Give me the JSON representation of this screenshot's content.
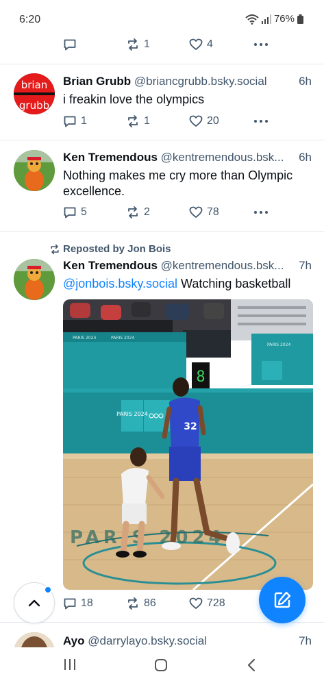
{
  "status": {
    "time": "6:20",
    "battery": "76%"
  },
  "top_actions": {
    "reposts": "1",
    "likes": "4"
  },
  "posts": [
    {
      "author": "Brian Grubb",
      "handle": "@briancgrubb.bsky.social",
      "time": "6h",
      "text": "i freakin love the olympics",
      "avatar_text": [
        "brian",
        "grubb"
      ],
      "replies": "1",
      "reposts": "1",
      "likes": "20"
    },
    {
      "author": "Ken Tremendous",
      "handle": "@kentremendous.bsk...",
      "time": "6h",
      "text": "Nothing makes me cry more than Olympic excellence.",
      "replies": "5",
      "reposts": "2",
      "likes": "78"
    },
    {
      "repost_label": "Reposted by Jon Bois",
      "author": "Ken Tremendous",
      "handle": "@kentremendous.bsk...",
      "time": "7h",
      "mention": "@jonbois.bsky.social",
      "text": " Watching basketball",
      "image": {
        "signage": "PARIS 2024",
        "scoreboard": "8",
        "court_text": "PARIS 2024",
        "jersey": "32"
      },
      "replies": "18",
      "reposts": "86",
      "likes": "728"
    },
    {
      "author": "Ayo",
      "handle": "@darrylayo.bsky.social",
      "time": "7h"
    }
  ],
  "icons": {
    "reply": "speech-bubble-icon",
    "repost": "repost-arrows-icon",
    "like": "heart-icon",
    "more": "ellipsis-icon",
    "scroll_top": "chevron-up-icon",
    "compose": "pencil-square-icon"
  },
  "colors": {
    "accent": "#1083fe",
    "muted": "#42576c"
  }
}
